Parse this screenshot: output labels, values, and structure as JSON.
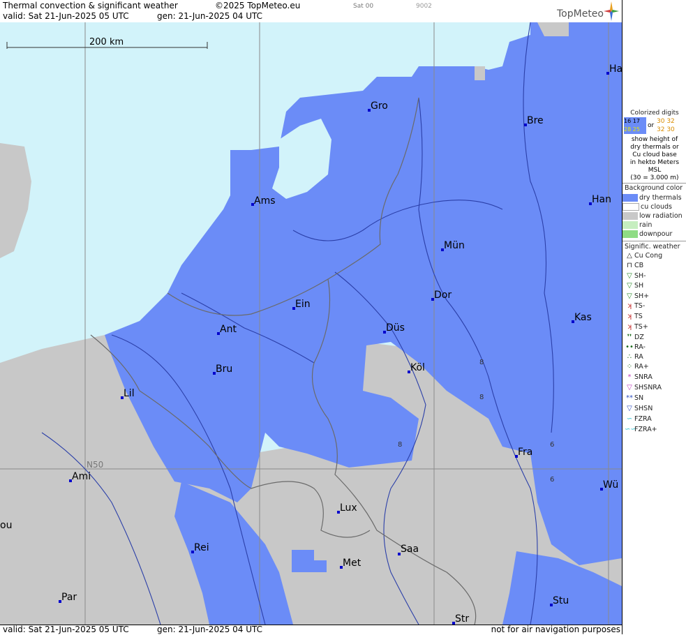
{
  "header": {
    "title": "Thermal convection & significant weather",
    "copyright": "©2025 TopMeteo.eu",
    "run": "Sat 00",
    "code": "9002",
    "valid": "valid:  Sat  21-Jun-2025  05 UTC",
    "gen": "gen:  21-Jun-2025 04 UTC",
    "logo": "TopMeteo"
  },
  "map": {
    "scale_label": "200 km",
    "lat_label": "N50",
    "cities": [
      {
        "name": "Ha"
      },
      {
        "name": "Gro"
      },
      {
        "name": "Bre"
      },
      {
        "name": "Ams"
      },
      {
        "name": "Han"
      },
      {
        "name": "Mün"
      },
      {
        "name": "Ein"
      },
      {
        "name": "Dor"
      },
      {
        "name": "Ant"
      },
      {
        "name": "Düs"
      },
      {
        "name": "Kas"
      },
      {
        "name": "Bru"
      },
      {
        "name": "Köl"
      },
      {
        "name": "Lil"
      },
      {
        "name": "Fra"
      },
      {
        "name": "Ami"
      },
      {
        "name": "Wü"
      },
      {
        "name": "Lux"
      },
      {
        "name": "ou"
      },
      {
        "name": "Rei"
      },
      {
        "name": "Saa"
      },
      {
        "name": "Met"
      },
      {
        "name": "Stu"
      },
      {
        "name": "Par"
      },
      {
        "name": "Str"
      }
    ],
    "digits": [
      "8",
      "8",
      "8",
      "6",
      "6"
    ]
  },
  "footer": {
    "valid": "valid:  Sat  21-Jun-2025  05 UTC",
    "gen": "gen:  21-Jun-2025 04 UTC",
    "disclaimer": "not for air navigation purposes"
  },
  "legend": {
    "digits_title": [
      "Colorized digits"
    ],
    "digit_samples": {
      "a": "16 17",
      "b": "28 25",
      "c": "30 32",
      "d": "32 30",
      "or": "or"
    },
    "digits_text": [
      "show height of",
      "dry thermals or",
      "Cu cloud base",
      "in hekto Meters",
      "MSL",
      "(30 = 3.000 m)"
    ],
    "bg_title": "Background color",
    "bg_items": [
      {
        "label": "dry thermals",
        "color": "#6b8cf7"
      },
      {
        "label": "cu clouds",
        "color": "#ffffff"
      },
      {
        "label": "low radiation",
        "color": "#c8c8c8"
      },
      {
        "label": "rain",
        "color": "#c6eec0"
      },
      {
        "label": "downpour",
        "color": "#8fdc84"
      }
    ],
    "sig_title": "Signific. weather",
    "sig_items": [
      {
        "label": "Cu Cong",
        "icon": "cu-cong-icon"
      },
      {
        "label": "CB",
        "icon": "cb-icon"
      },
      {
        "label": "SH-",
        "icon": "shower-light-icon"
      },
      {
        "label": "SH",
        "icon": "shower-icon"
      },
      {
        "label": "SH+",
        "icon": "shower-heavy-icon"
      },
      {
        "label": "TS-",
        "icon": "thunder-light-icon"
      },
      {
        "label": "TS",
        "icon": "thunder-icon"
      },
      {
        "label": "TS+",
        "icon": "thunder-heavy-icon"
      },
      {
        "label": "DZ",
        "icon": "drizzle-icon"
      },
      {
        "label": "RA-",
        "icon": "rain-light-icon"
      },
      {
        "label": "RA",
        "icon": "rain-icon"
      },
      {
        "label": "RA+",
        "icon": "rain-heavy-icon"
      },
      {
        "label": "SNRA",
        "icon": "snow-rain-icon"
      },
      {
        "label": "SHSNRA",
        "icon": "snow-rain-shower-icon"
      },
      {
        "label": "SN",
        "icon": "snow-icon"
      },
      {
        "label": "SHSN",
        "icon": "snow-shower-icon"
      },
      {
        "label": "FZRA",
        "icon": "freezing-rain-icon"
      },
      {
        "label": "FZRA+",
        "icon": "freezing-rain-heavy-icon"
      }
    ]
  }
}
